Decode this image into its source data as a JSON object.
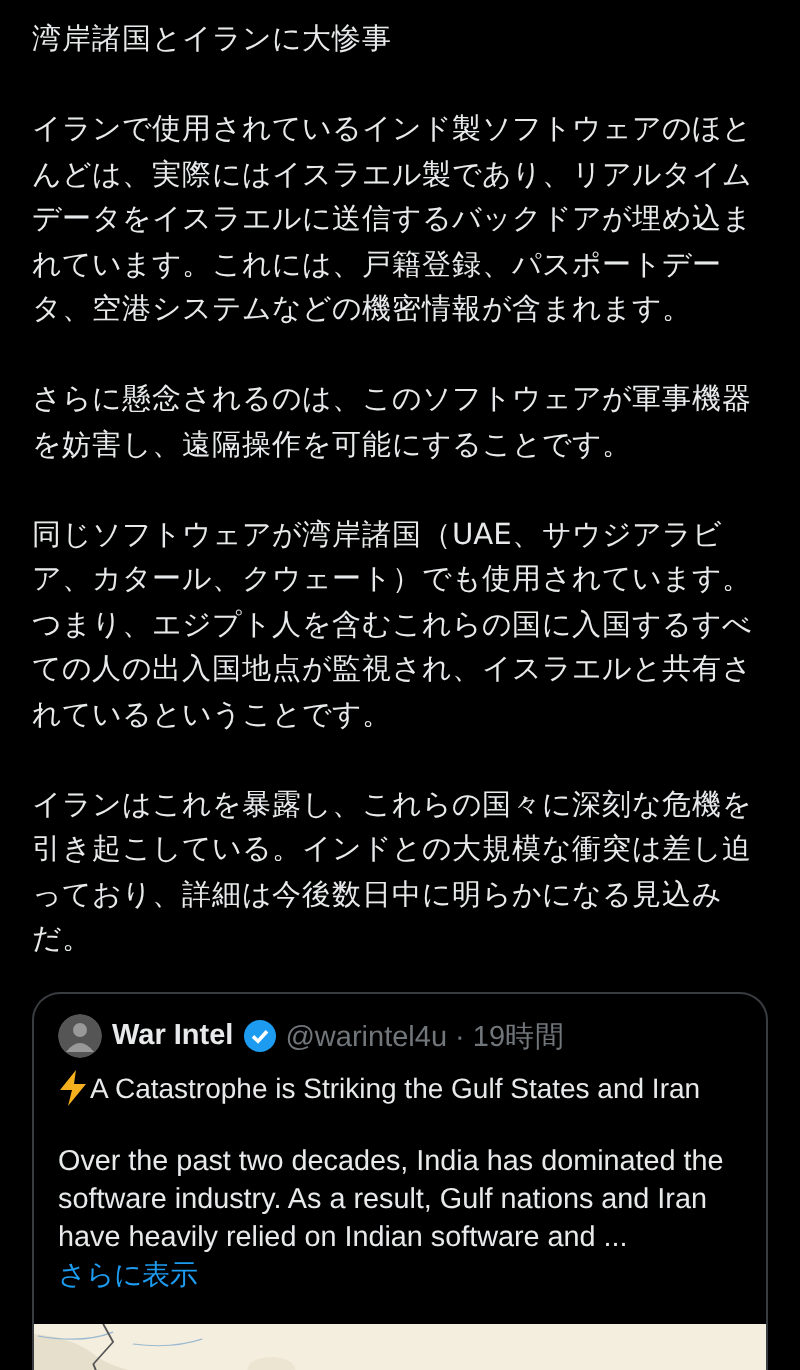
{
  "post": {
    "title": "湾岸諸国とイランに大惨事",
    "paragraphs": [
      "イランで使用されているインド製ソフトウェアのほとんどは、実際にはイスラエル製であり、リアルタイムデータをイスラエルに送信するバックドアが埋め込まれています。これには、戸籍登録、パスポートデータ、空港システムなどの機密情報が含まれます。",
      "さらに懸念されるのは、このソフトウェアが軍事機器を妨害し、遠隔操作を可能にすることです。",
      "同じソフトウェアが湾岸諸国（UAE、サウジアラビア、カタール、クウェート）でも使用されています。つまり、エジプト人を含むこれらの国に入国するすべての人の出入国地点が監視され、イスラエルと共有されているということです。",
      "イランはこれを暴露し、これらの国々に深刻な危機を引き起こしている。インドとの大規模な衝突は差し迫っており、詳細は今後数日中に明らかになる見込みだ。"
    ]
  },
  "quote": {
    "author": "War Intel",
    "verified": true,
    "handle_line": "@warintel4u · 19時間",
    "headline": "A Catastrophe is Striking the Gulf States and Iran",
    "body": "Over the past two decades, India has dominated the software industry. As a result, Gulf nations and Iran have heavily relied on Indian software and ...",
    "show_more": "さらに表示"
  }
}
